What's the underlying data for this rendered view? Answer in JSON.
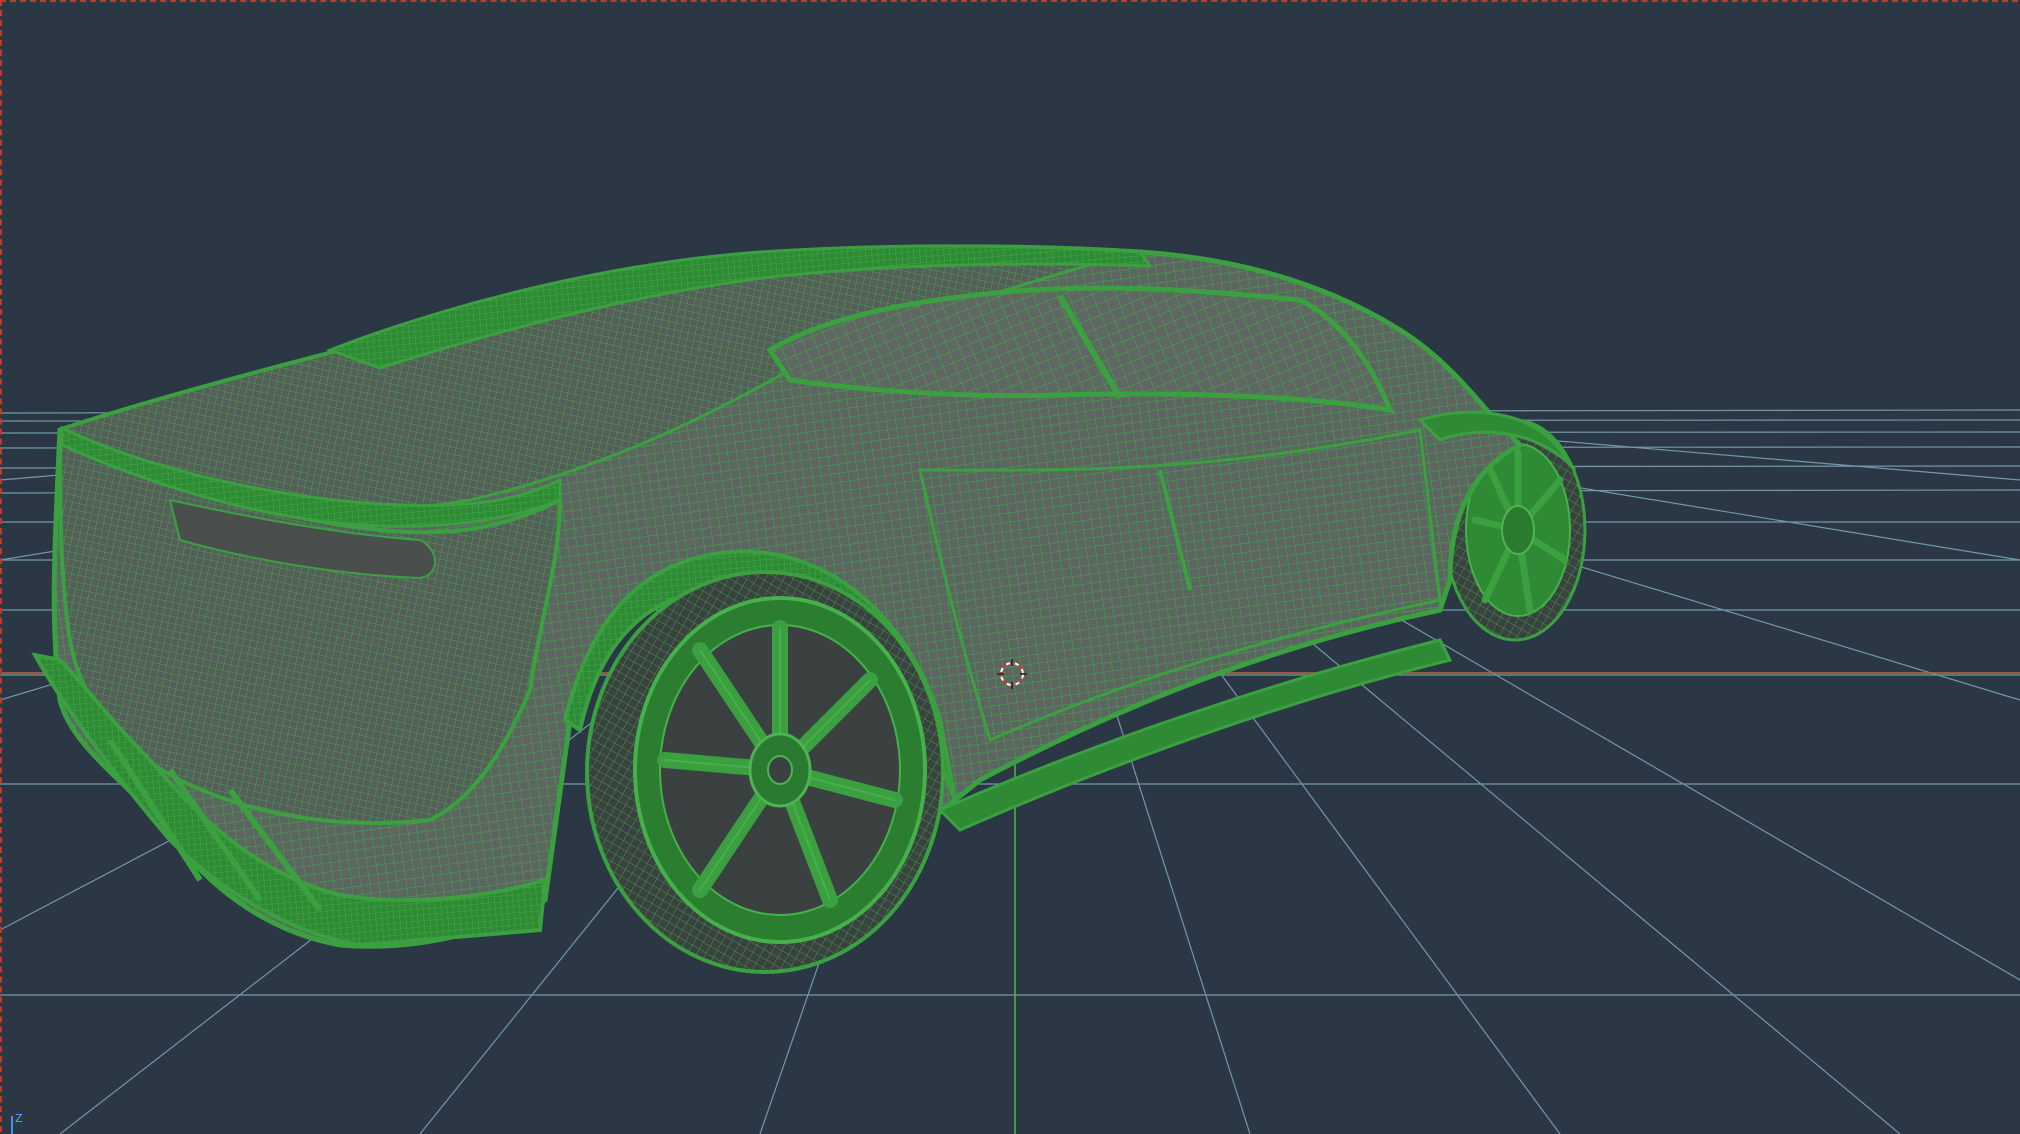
{
  "viewport": {
    "background": "#2b3744",
    "grid_color": "#7ea9bd",
    "x_axis_color": "#c4603a",
    "y_axis_color": "#4caf3a",
    "frame_color": "#c0392b"
  },
  "model": {
    "wire_color": "#3aa040",
    "shell_color": "#2e7d32",
    "shade_color": "#5b6160",
    "display_mode": "wireframe-on-shaded"
  },
  "gizmo": {
    "axis_label": "Z",
    "axis_color": "#4a90e2"
  },
  "icons": {
    "cursor": "3d-cursor-icon"
  }
}
